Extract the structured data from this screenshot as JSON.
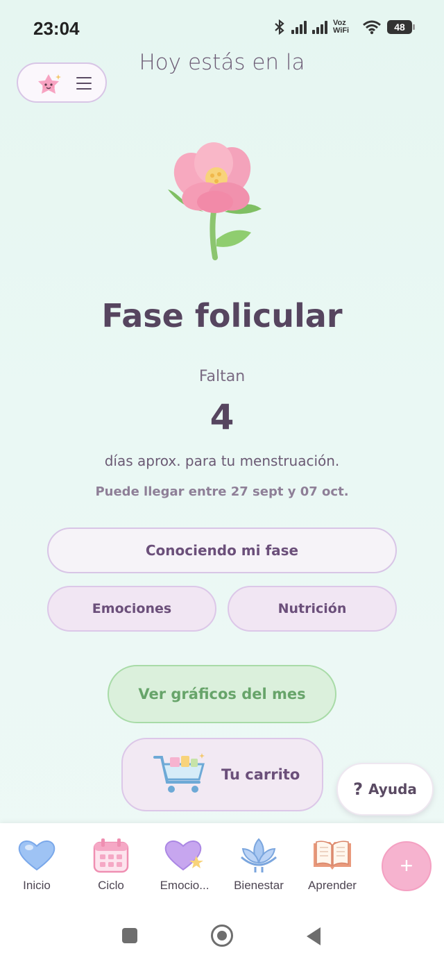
{
  "status": {
    "time": "23:04",
    "network": "Voz WiFi",
    "battery": "48"
  },
  "header": {
    "subtitle": "Hoy estás en la"
  },
  "phase": {
    "name": "Fase folicular",
    "countdown_label": "Faltan",
    "days": "4",
    "days_text": "días aprox. para tu menstruación.",
    "range_text": "Puede llegar entre 27 sept y 07 oct."
  },
  "buttons": {
    "phase_info": "Conociendo mi fase",
    "emotions": "Emociones",
    "nutrition": "Nutrición",
    "charts": "Ver gráficos del mes",
    "cart": "Tu carrito",
    "help": "Ayuda",
    "help_symbol": "?",
    "add": "+"
  },
  "nav": {
    "items": [
      {
        "label": "Inicio",
        "icon": "heart-icon"
      },
      {
        "label": "Ciclo",
        "icon": "calendar-icon"
      },
      {
        "label": "Emocio...",
        "icon": "star-heart-icon"
      },
      {
        "label": "Bienestar",
        "icon": "lotus-icon"
      },
      {
        "label": "Aprender",
        "icon": "book-icon"
      }
    ]
  },
  "colors": {
    "background": "#e6f6f1",
    "title": "#56455f",
    "accent_purple": "#d8c5e6",
    "accent_green": "#a8dba7",
    "fab_pink": "#f6b3cf"
  }
}
